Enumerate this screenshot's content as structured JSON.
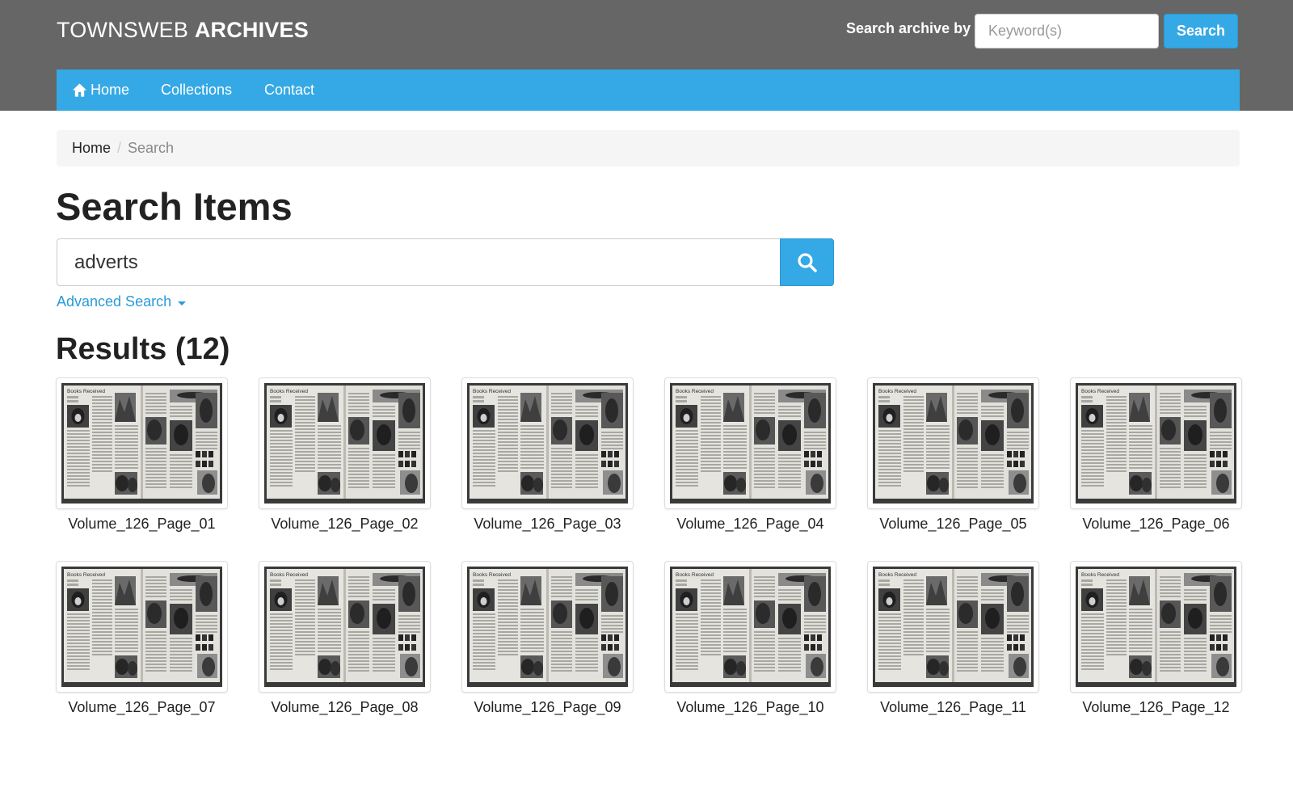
{
  "header": {
    "logo_light": "TOWNSWEB ",
    "logo_bold": "ARCHIVES",
    "search_by_label": "Search archive by",
    "keyword_placeholder": "Keyword(s)",
    "search_button": "Search"
  },
  "nav": {
    "items": [
      {
        "label": "Home",
        "icon": "home-icon"
      },
      {
        "label": "Collections"
      },
      {
        "label": "Contact"
      }
    ]
  },
  "breadcrumb": {
    "home": "Home",
    "separator": "/",
    "current": "Search"
  },
  "search": {
    "title": "Search Items",
    "query": "adverts",
    "button_icon": "magnifier-icon",
    "advanced_label": "Advanced Search"
  },
  "results": {
    "title": "Results (12)",
    "thumb_header": "Books Received",
    "items": [
      {
        "label": "Volume_126_Page_01"
      },
      {
        "label": "Volume_126_Page_02"
      },
      {
        "label": "Volume_126_Page_03"
      },
      {
        "label": "Volume_126_Page_04"
      },
      {
        "label": "Volume_126_Page_05"
      },
      {
        "label": "Volume_126_Page_06"
      },
      {
        "label": "Volume_126_Page_07"
      },
      {
        "label": "Volume_126_Page_08"
      },
      {
        "label": "Volume_126_Page_09"
      },
      {
        "label": "Volume_126_Page_10"
      },
      {
        "label": "Volume_126_Page_11"
      },
      {
        "label": "Volume_126_Page_12"
      }
    ]
  },
  "colors": {
    "header_bg": "#666666",
    "accent": "#35a9e6",
    "link": "#2a9bd8",
    "breadcrumb_bg": "#f5f5f5"
  }
}
